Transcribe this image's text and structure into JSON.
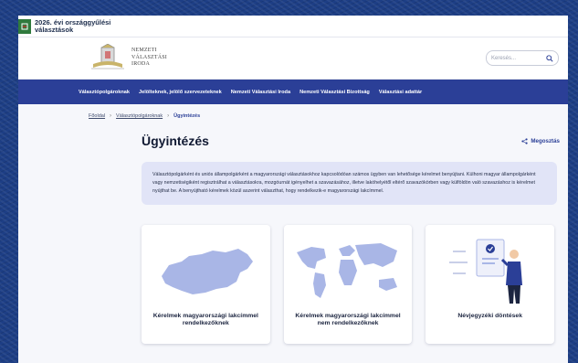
{
  "topbar": {
    "title": "2026. évi országgyűlési választások"
  },
  "header": {
    "logo_lines": [
      "NEMZETI",
      "VÁLASZTÁSI",
      "IRODA"
    ],
    "search_placeholder": "Keresés..."
  },
  "nav": {
    "items": [
      "Választópolgároknak",
      "Jelölteknek, jelölő szervezeteknek",
      "Nemzeti Választási Iroda",
      "Nemzeti Választási Bizottság",
      "Választási adattár"
    ]
  },
  "breadcrumb": {
    "home": "Főoldal",
    "parent": "Választópolgároknak",
    "current": "Ügyintézés"
  },
  "main": {
    "title": "Ügyintézés",
    "share_label": "Megosztás",
    "info_text": "Választópolgárként és uniós állampolgárként a magyarországi választásokhoz kapcsolódóan számos ügyben van lehetősége kérelmet benyújtani. Külhoni magyar állampolgárként vagy nemzetiségiként regisztrálhat a választásokra, mozgóurnát igényelhet a szavazásához, illetve lakóhelyétől eltérő szavazókörben vagy külföldön való szavazáshoz is kérelmet nyújthat be. A benyújtható kérelmek közül aszerint választhat, hogy rendelkezik-e magyarországi lakcímmel.",
    "cards": [
      {
        "label": "Kérelmek magyarországi lakcímmel rendelkezőknek"
      },
      {
        "label": "Kérelmek magyarországi lakcímmel nem rendelkezőknek"
      },
      {
        "label": "Névjegyzéki döntések"
      }
    ]
  },
  "colors": {
    "nav_bg": "#2b3f97",
    "info_bg": "#e1e4f7",
    "map_fill": "#a9b6e6"
  }
}
